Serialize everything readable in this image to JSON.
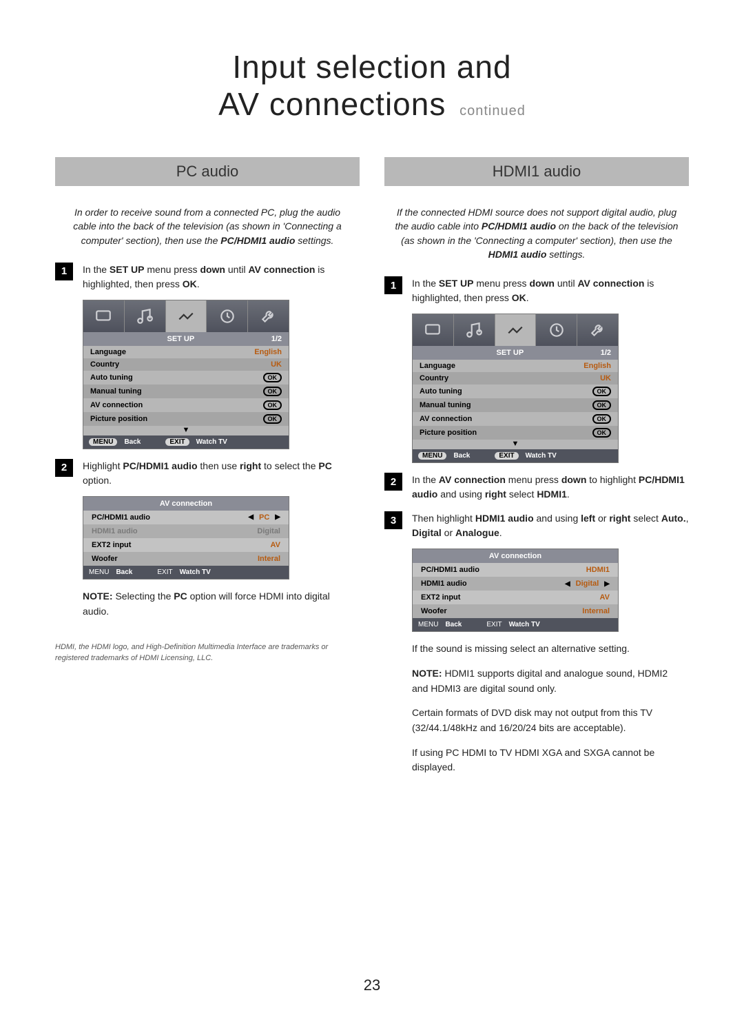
{
  "title": {
    "line1": "Input selection and",
    "line2": "AV connections",
    "cont": "continued"
  },
  "page_number": "23",
  "left": {
    "header": "PC audio",
    "intro_parts": {
      "a": "In order to receive sound from a connected PC, plug the audio cable into the back of the television (as shown in 'Connecting a computer' section), then use the ",
      "b": "PC/HDMI1 audio",
      "c": " settings."
    },
    "step1_parts": {
      "a": "In the ",
      "b": "SET UP",
      "c": " menu press ",
      "d": "down",
      "e": " until ",
      "f": "AV connection",
      "g": " is highlighted, then press ",
      "h": "OK",
      "i": "."
    },
    "step2_parts": {
      "a": "Highlight ",
      "b": "PC/HDMI1 audio",
      "c": " then use ",
      "d": "right",
      "e": " to select the ",
      "f": "PC",
      "g": " option."
    },
    "note_parts": {
      "a": "NOTE:",
      "b": " Selecting the ",
      "c": "PC",
      "d": " option will force HDMI into digital audio."
    },
    "trademark": "HDMI, the HDMI logo, and High-Definition Multimedia Interface are trademarks or registered trademarks of HDMI Licensing, LLC."
  },
  "right": {
    "header": "HDMI1 audio",
    "intro_parts": {
      "a": "If the connected HDMI source does not support digital audio, plug the audio cable into ",
      "b": "PC/HDMI1 audio",
      "c": " on the back of the television (as shown in the 'Connecting a computer' section), then use the ",
      "d": "HDMI1 audio",
      "e": " settings."
    },
    "step1_parts": {
      "a": "In the ",
      "b": "SET UP",
      "c": " menu press ",
      "d": "down",
      "e": " until ",
      "f": "AV connection",
      "g": " is highlighted, then press ",
      "h": "OK",
      "i": "."
    },
    "step2_parts": {
      "a": "In the ",
      "b": "AV connection",
      "c": " menu press ",
      "d": "down",
      "e": " to highlight ",
      "f": "PC/HDMI1 audio",
      "g": " and using ",
      "h": "right",
      "i": " select ",
      "j": "HDMI1",
      "k": "."
    },
    "step3_parts": {
      "a": "Then highlight ",
      "b": "HDMI1 audio",
      "c": " and using ",
      "d": "left",
      "e": " or ",
      "f": "right",
      "g": " select ",
      "h": "Auto.",
      "i": ", ",
      "j": "Digital",
      "k": " or ",
      "l": "Analogue",
      "m": "."
    },
    "tail1": "If the sound is missing select an alternative setting.",
    "note_parts": {
      "a": "NOTE:",
      "b": " HDMI1 supports digital and analogue sound, HDMI2 and HDMI3 are digital sound only."
    },
    "tail3": "Certain formats of DVD disk may not output from this TV (32/44.1/48kHz and 16/20/24 bits are acceptable).",
    "tail4": "If using PC HDMI to TV HDMI XGA and SXGA cannot be displayed."
  },
  "osd_setup": {
    "title": "SET UP",
    "page": "1/2",
    "rows": [
      {
        "label": "Language",
        "value": "English",
        "type": "text"
      },
      {
        "label": "Country",
        "value": "UK",
        "type": "text"
      },
      {
        "label": "Auto tuning",
        "value": "OK",
        "type": "ok"
      },
      {
        "label": "Manual tuning",
        "value": "OK",
        "type": "ok"
      },
      {
        "label": "AV connection",
        "value": "OK",
        "type": "ok"
      },
      {
        "label": "Picture position",
        "value": "OK",
        "type": "ok"
      }
    ],
    "foot": {
      "menu": "MENU",
      "back": "Back",
      "exit": "EXIT",
      "watch": "Watch TV"
    }
  },
  "av_left": {
    "title": "AV connection",
    "rows": [
      {
        "label": "PC/HDMI1 audio",
        "value": "PC",
        "selected": true
      },
      {
        "label": "HDMI1 audio",
        "value": "Digital",
        "dimmed": true
      },
      {
        "label": "EXT2 input",
        "value": "AV"
      },
      {
        "label": "Woofer",
        "value": "Interal"
      }
    ],
    "foot": {
      "menu": "MENU",
      "back": "Back",
      "exit": "EXIT",
      "watch": "Watch TV"
    }
  },
  "av_right": {
    "title": "AV connection",
    "rows": [
      {
        "label": "PC/HDMI1 audio",
        "value": "HDMI1"
      },
      {
        "label": "HDMI1 audio",
        "value": "Digital",
        "selected": true
      },
      {
        "label": "EXT2 input",
        "value": "AV"
      },
      {
        "label": "Woofer",
        "value": "Internal"
      }
    ],
    "foot": {
      "menu": "MENU",
      "back": "Back",
      "exit": "EXIT",
      "watch": "Watch TV"
    }
  },
  "step_numbers": {
    "n1": "1",
    "n2": "2",
    "n3": "3"
  },
  "arrows": {
    "left": "◀",
    "right": "▶",
    "down": "▼"
  }
}
